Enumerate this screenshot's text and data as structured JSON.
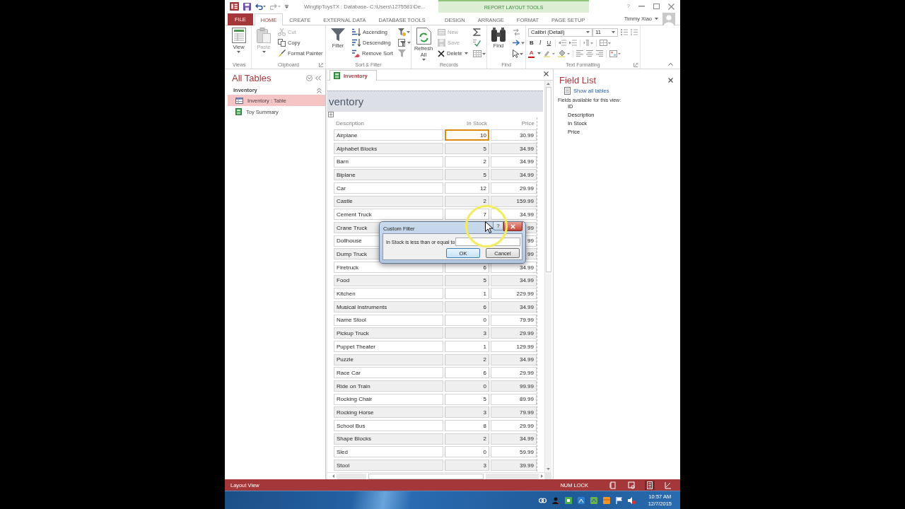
{
  "window": {
    "title": "WingtipToysTX : Database- C:\\Users\\1275581\\De...",
    "context_header": "REPORT LAYOUT TOOLS",
    "help_button": "?",
    "user": "Timmy Xiao"
  },
  "tabs": [
    {
      "label": "FILE",
      "kind": "file",
      "selected": false
    },
    {
      "label": "HOME",
      "kind": "tab",
      "selected": true
    },
    {
      "label": "CREATE",
      "kind": "tab",
      "selected": false
    },
    {
      "label": "EXTERNAL DATA",
      "kind": "tab",
      "selected": false
    },
    {
      "label": "DATABASE TOOLS",
      "kind": "tab",
      "selected": false
    },
    {
      "label": "DESIGN",
      "kind": "context",
      "selected": false
    },
    {
      "label": "ARRANGE",
      "kind": "context",
      "selected": false
    },
    {
      "label": "FORMAT",
      "kind": "context",
      "selected": false
    },
    {
      "label": "PAGE SETUP",
      "kind": "context",
      "selected": false
    }
  ],
  "ribbon": {
    "groups": [
      {
        "label": "Views",
        "launcher": false,
        "buttons": [
          {
            "label": "View",
            "kind": "large",
            "dropdown": true,
            "disabled": false
          }
        ]
      },
      {
        "label": "Clipboard",
        "launcher": true,
        "buttons": [
          {
            "label": "Paste",
            "kind": "large",
            "dropdown": true,
            "disabled": true
          },
          {
            "label": "Cut",
            "kind": "small",
            "dropdown": false,
            "disabled": true
          },
          {
            "label": "Copy",
            "kind": "small",
            "dropdown": false,
            "disabled": false
          },
          {
            "label": "Format Painter",
            "kind": "small",
            "dropdown": false,
            "disabled": false
          }
        ]
      },
      {
        "label": "Sort & Filter",
        "launcher": false,
        "buttons": [
          {
            "label": "Filter",
            "kind": "large",
            "dropdown": false,
            "disabled": false
          },
          {
            "label": "Ascending",
            "kind": "small",
            "dropdown": false,
            "disabled": false
          },
          {
            "label": "Descending",
            "kind": "small",
            "dropdown": false,
            "disabled": false
          },
          {
            "label": "Remove Sort",
            "kind": "small",
            "dropdown": false,
            "disabled": false
          }
        ]
      },
      {
        "label": "Records",
        "launcher": false,
        "buttons": [
          {
            "label": "Refresh All",
            "kind": "large",
            "dropdown": true,
            "disabled": false
          },
          {
            "label": "New",
            "kind": "small",
            "dropdown": false,
            "disabled": true
          },
          {
            "label": "Save",
            "kind": "small",
            "dropdown": false,
            "disabled": true
          },
          {
            "label": "Delete",
            "kind": "small",
            "dropdown": true,
            "disabled": false
          }
        ]
      },
      {
        "label": "Find",
        "launcher": false,
        "buttons": [
          {
            "label": "Find",
            "kind": "large",
            "dropdown": false,
            "disabled": false
          }
        ]
      },
      {
        "label": "Text Formatting",
        "launcher": true,
        "font": "Calibri (Detail)",
        "size": "11",
        "format_buttons": [
          {
            "label": "B",
            "kind": "bold"
          },
          {
            "label": "I",
            "kind": "italic"
          },
          {
            "label": "U",
            "kind": "underline"
          }
        ],
        "font_color": "A"
      }
    ]
  },
  "navigation": {
    "title": "All Tables",
    "groups": [
      {
        "label": "Inventory",
        "expanded": true,
        "items": [
          {
            "label": "Inventory : Table",
            "kind": "table",
            "selected": true
          },
          {
            "label": "Toy Summary",
            "kind": "report",
            "selected": false
          }
        ]
      }
    ]
  },
  "document_tabs": [
    {
      "label": "Inventory",
      "selected": true
    }
  ],
  "report": {
    "title": "ventory",
    "columns": [
      {
        "label": "Description",
        "selected": false
      },
      {
        "label": "In Stock",
        "selected": true
      },
      {
        "label": "Price",
        "selected": false
      }
    ],
    "rows": [
      {
        "description": "Airplane",
        "in_stock": "10",
        "price": "30.99",
        "focused": true
      },
      {
        "description": "Alphabet Blocks",
        "in_stock": "5",
        "price": "34.99",
        "focused": false
      },
      {
        "description": "Barn",
        "in_stock": "2",
        "price": "34.99",
        "focused": false
      },
      {
        "description": "Biplane",
        "in_stock": "5",
        "price": "34.99",
        "focused": false
      },
      {
        "description": "Car",
        "in_stock": "12",
        "price": "29.99",
        "focused": false
      },
      {
        "description": "Castle",
        "in_stock": "2",
        "price": "159.99",
        "focused": false
      },
      {
        "description": "Cement Truck",
        "in_stock": "7",
        "price": "34.99",
        "focused": false
      },
      {
        "description": "Crane Truck",
        "price": "99"
      },
      {
        "description": "Dollhouse",
        "price": "99"
      },
      {
        "description": "Dump Truck",
        "price": "99"
      },
      {
        "description": "Firetruck",
        "in_stock": "6",
        "price": "34.99",
        "focused": false
      },
      {
        "description": "Food",
        "in_stock": "5",
        "price": "34.99",
        "focused": false
      },
      {
        "description": "Kitchen",
        "in_stock": "1",
        "price": "229.99",
        "focused": false
      },
      {
        "description": "Musical Instruments",
        "in_stock": "6",
        "price": "34.99",
        "focused": false
      },
      {
        "description": "Name Stool",
        "in_stock": "0",
        "price": "79.99",
        "focused": false
      },
      {
        "description": "Pickup Truck",
        "in_stock": "3",
        "price": "29.99",
        "focused": false
      },
      {
        "description": "Puppet Theater",
        "in_stock": "1",
        "price": "129.99",
        "focused": false
      },
      {
        "description": "Puzzle",
        "in_stock": "2",
        "price": "34.99",
        "focused": false
      },
      {
        "description": "Race Car",
        "in_stock": "6",
        "price": "29.99",
        "focused": false
      },
      {
        "description": "Ride on Train",
        "in_stock": "0",
        "price": "99.99",
        "focused": false
      },
      {
        "description": "Rocking Chair",
        "in_stock": "5",
        "price": "89.99",
        "focused": false
      },
      {
        "description": "Rocking Horse",
        "in_stock": "3",
        "price": "79.99",
        "focused": false
      },
      {
        "description": "School Bus",
        "in_stock": "8",
        "price": "29.99",
        "focused": false
      },
      {
        "description": "Shape Blocks",
        "in_stock": "2",
        "price": "34.99",
        "focused": false
      },
      {
        "description": "Sled",
        "in_stock": "0",
        "price": "59.99",
        "focused": false
      },
      {
        "description": "Stool",
        "in_stock": "3",
        "price": "39.99",
        "focused": false
      }
    ]
  },
  "field_list": {
    "title": "Field List",
    "link": "Show all tables",
    "caption": "Fields available for this view:",
    "fields": [
      "ID",
      "Description",
      "In Stock",
      "Price"
    ]
  },
  "dialog": {
    "title": "Custom Filter",
    "help_button": "?",
    "prompt": "In Stock is less than or equal to",
    "buttons": [
      {
        "label": "OK",
        "focused": true
      },
      {
        "label": "Cancel",
        "focused": false
      }
    ]
  },
  "status_bar": {
    "view": "Layout View",
    "num_lock": "NUM LOCK",
    "view_buttons": [
      {
        "selected": false
      },
      {
        "selected": false
      },
      {
        "selected": true
      },
      {
        "selected": false
      }
    ]
  },
  "taskbar": {
    "time": "10:57 AM",
    "date": "12/7/2015"
  }
}
